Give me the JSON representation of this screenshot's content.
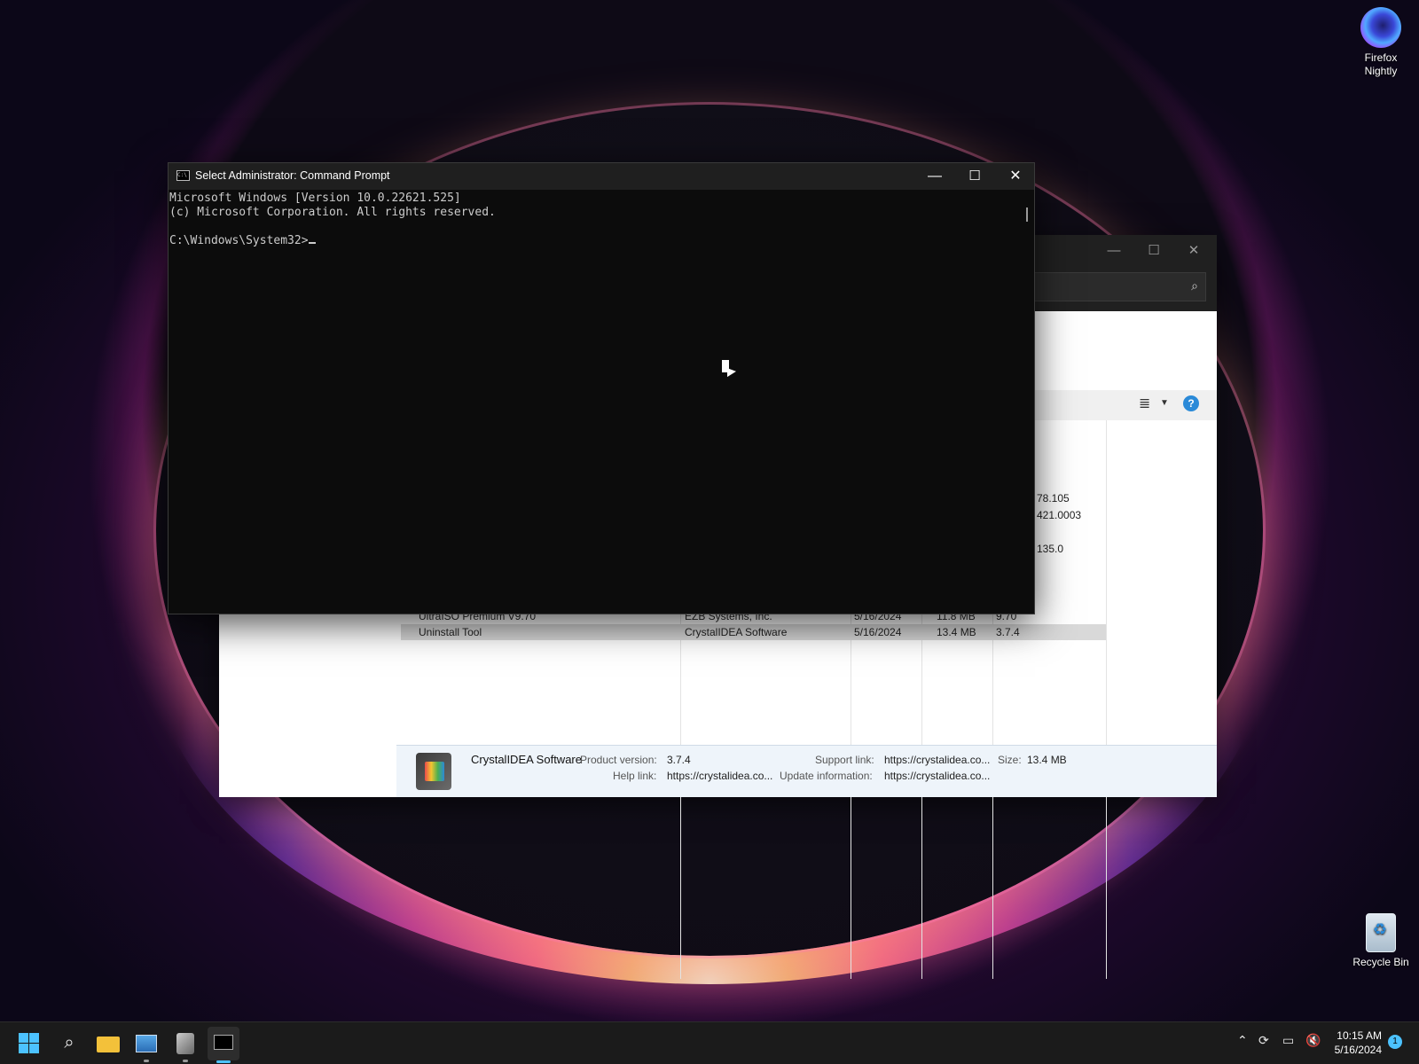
{
  "desktop": {
    "icons": [
      {
        "label_line1": "Firefox",
        "label_line2": "Nightly"
      },
      {
        "label": "Recycle Bin"
      }
    ]
  },
  "cmd": {
    "title": "Select Administrator: Command Prompt",
    "lines": [
      "Microsoft Windows [Version 10.0.22621.525]",
      "(c) Microsoft Corporation. All rights reserved.",
      "",
      "C:\\Windows\\System32>"
    ],
    "controls": {
      "minimize": "—",
      "maximize": "☐",
      "close": "✕"
    }
  },
  "uninstall_tool": {
    "partial_versions": [
      "78.105",
      "421.0003",
      "135.0"
    ],
    "rows": [
      {
        "name": "UltraISO Premium V9.70",
        "publisher": "EZB Systems, Inc.",
        "date": "5/16/2024",
        "size": "11.8 MB",
        "version": "9.70"
      },
      {
        "name": "Uninstall Tool",
        "publisher": "CrystalIDEA Software",
        "date": "5/16/2024",
        "size": "13.4 MB",
        "version": "3.7.4",
        "selected": true
      }
    ],
    "details": {
      "publisher": "CrystalIDEA Software",
      "product_version_label": "Product version:",
      "product_version": "3.7.4",
      "help_link_label": "Help link:",
      "help_link": "https://crystalidea.co...",
      "support_link_label": "Support link:",
      "support_link": "https://crystalidea.co...",
      "update_info_label": "Update information:",
      "update_info": "https://crystalidea.co...",
      "size_label": "Size:",
      "size": "13.4 MB"
    }
  },
  "taskbar": {
    "time": "10:15 AM",
    "date": "5/16/2024",
    "notification_count": "1"
  }
}
